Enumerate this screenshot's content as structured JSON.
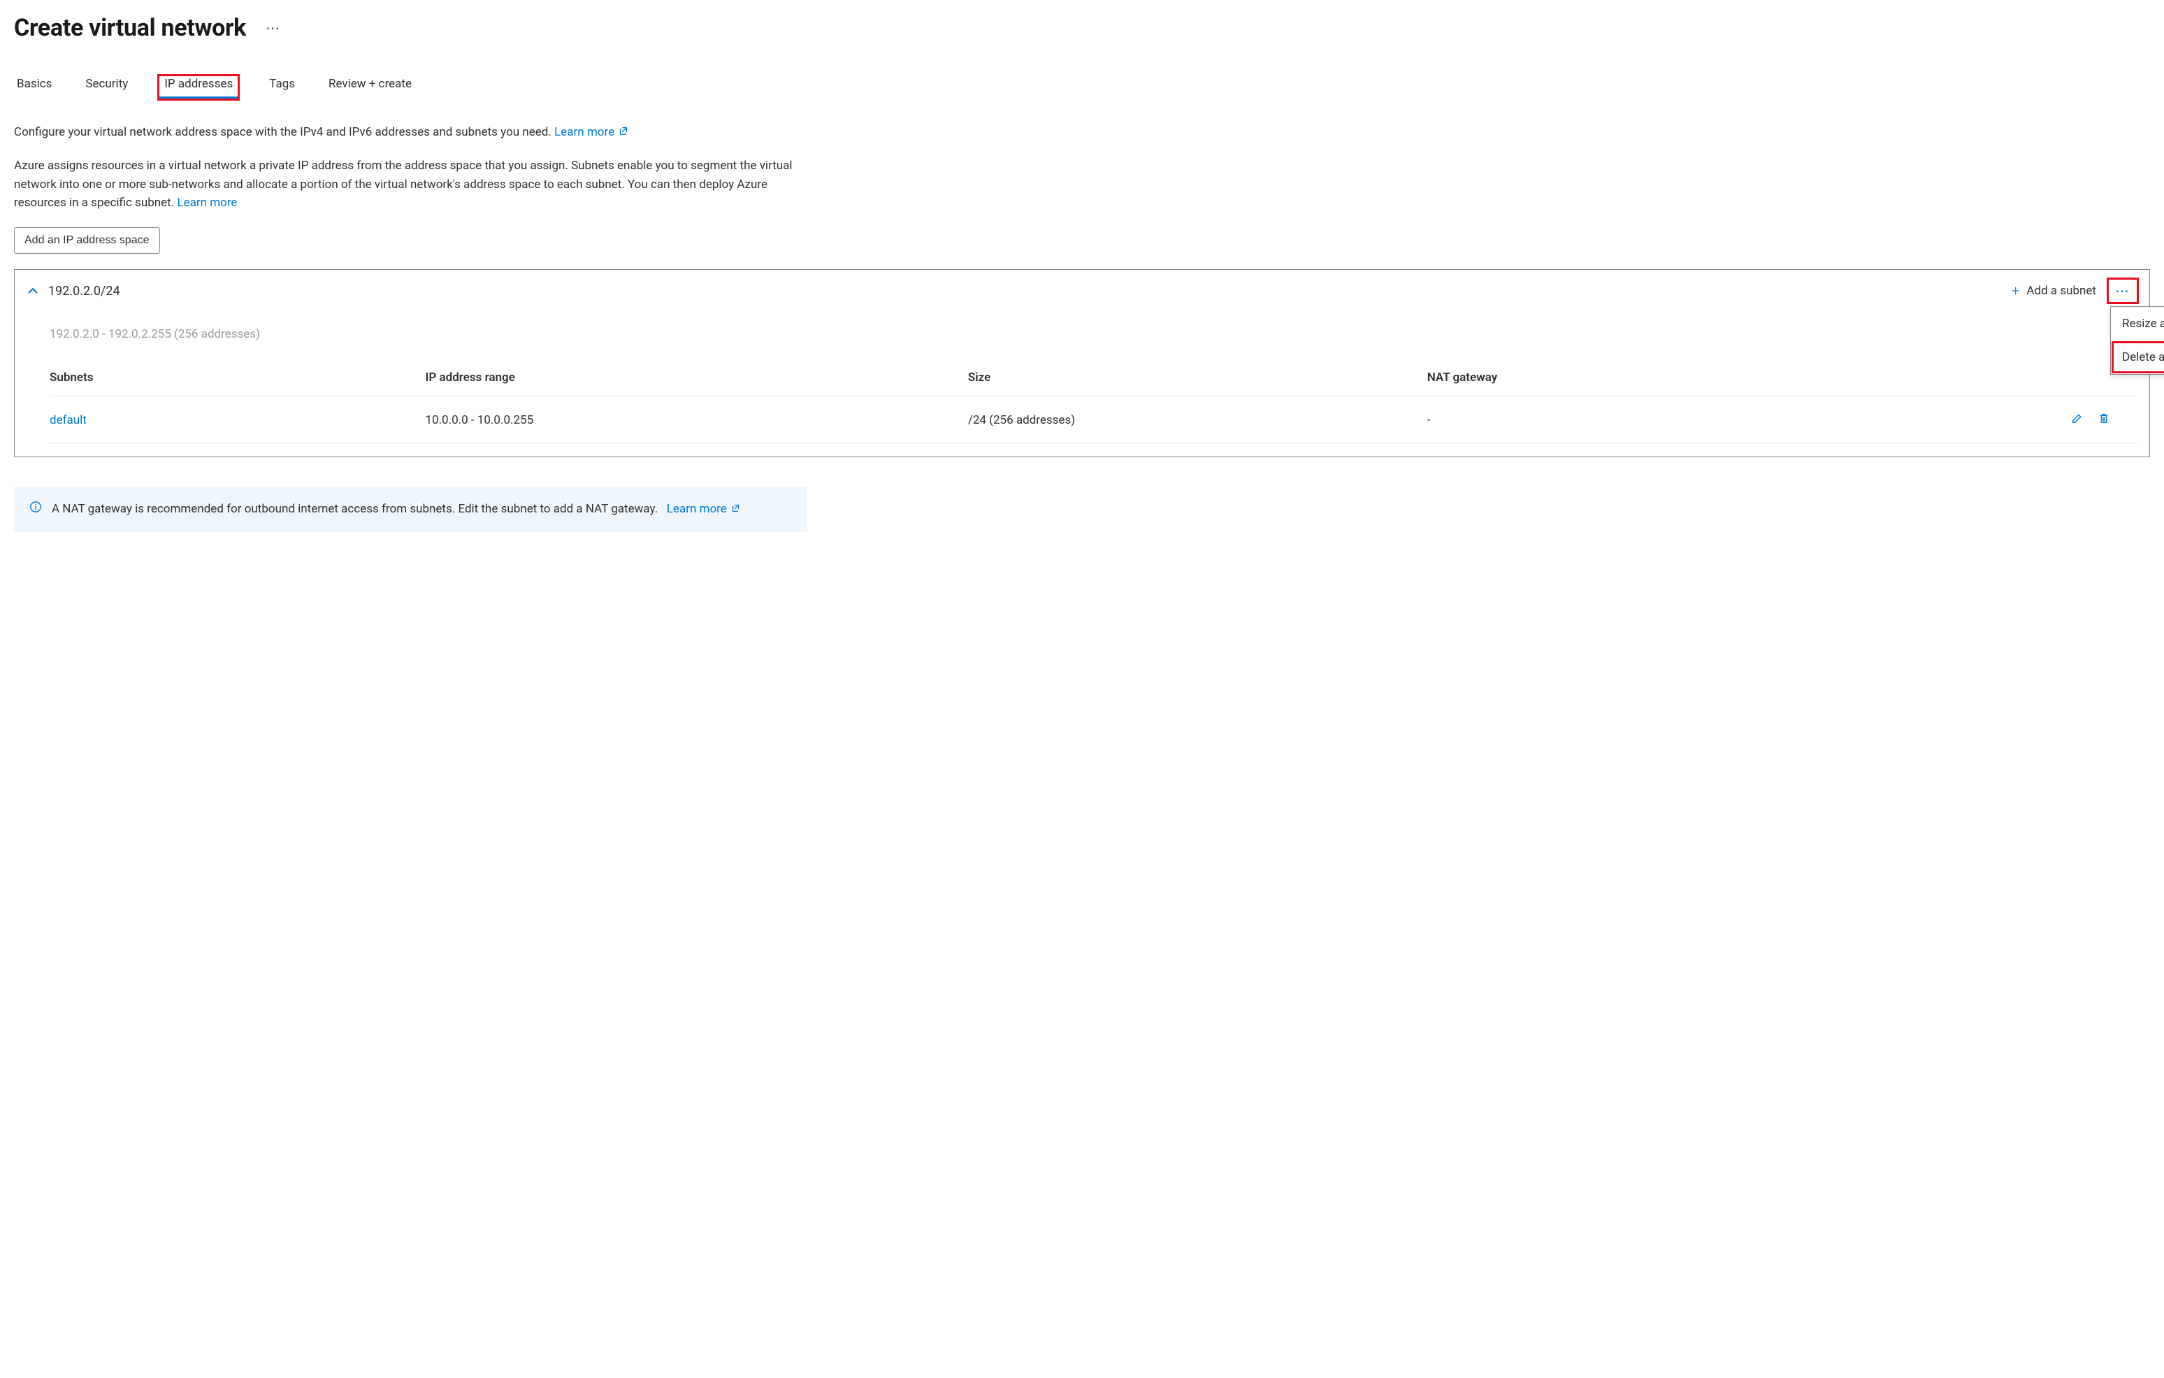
{
  "header": {
    "title": "Create virtual network"
  },
  "tabs": [
    {
      "label": "Basics",
      "active": false
    },
    {
      "label": "Security",
      "active": false
    },
    {
      "label": "IP addresses",
      "active": true
    },
    {
      "label": "Tags",
      "active": false
    },
    {
      "label": "Review + create",
      "active": false
    }
  ],
  "intro": {
    "line1": "Configure your virtual network address space with the IPv4 and IPv6 addresses and subnets you need.",
    "learn_more": "Learn more",
    "line2": "Azure assigns resources in a virtual network a private IP address from the address space that you assign. Subnets enable you to segment the virtual network into one or more sub-networks and allocate a portion of the virtual network's address space to each subnet. You can then deploy Azure resources in a specific subnet.",
    "learn_more2": "Learn more"
  },
  "buttons": {
    "add_address_space": "Add an IP address space",
    "add_subnet": "Add a subnet"
  },
  "address_space": {
    "cidr": "192.0.2.0/24",
    "range_text": "192.0.2.0 - 192.0.2.255 (256 addresses)",
    "table": {
      "headers": {
        "subnets": "Subnets",
        "ip_range": "IP address range",
        "size": "Size",
        "nat": "NAT gateway"
      },
      "rows": [
        {
          "name": "default",
          "ip_range": "10.0.0.0 - 10.0.0.255",
          "size": "/24 (256 addresses)",
          "nat": "-"
        }
      ]
    }
  },
  "context_menu": {
    "resize": "Resize address space",
    "delete": "Delete address space"
  },
  "info_banner": {
    "text": "A NAT gateway is recommended for outbound internet access from subnets. Edit the subnet to add a NAT gateway.",
    "learn_more": "Learn more"
  }
}
